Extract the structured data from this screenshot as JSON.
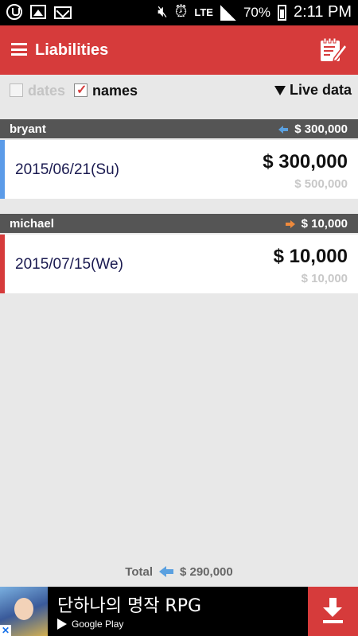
{
  "status_bar": {
    "network": "LTE",
    "battery": "70%",
    "time": "2:11 PM"
  },
  "toolbar": {
    "title": "Liabilities"
  },
  "filters": {
    "dates_label": "dates",
    "dates_checked": false,
    "names_label": "names",
    "names_checked": true,
    "live_data_label": "Live data"
  },
  "groups": [
    {
      "name": "bryant",
      "direction": "left",
      "amount": "$ 300,000",
      "entry": {
        "date": "2015/06/21(Su)",
        "amount": "$ 300,000",
        "original": "$ 500,000",
        "bar_color": "#5b9be8"
      }
    },
    {
      "name": "michael",
      "direction": "right",
      "amount": "$ 10,000",
      "entry": {
        "date": "2015/07/15(We)",
        "amount": "$ 10,000",
        "original": "$ 10,000",
        "bar_color": "#d63b3b"
      }
    }
  ],
  "total": {
    "label": "Total",
    "amount": "$ 290,000"
  },
  "ad": {
    "title": "단하나의 명작 RPG",
    "store": "Google Play"
  },
  "colors": {
    "accent": "#d63b3b",
    "header_bg": "#555555",
    "incoming_arrow": "#5aa0e0",
    "outgoing_arrow": "#ef8a3c"
  }
}
